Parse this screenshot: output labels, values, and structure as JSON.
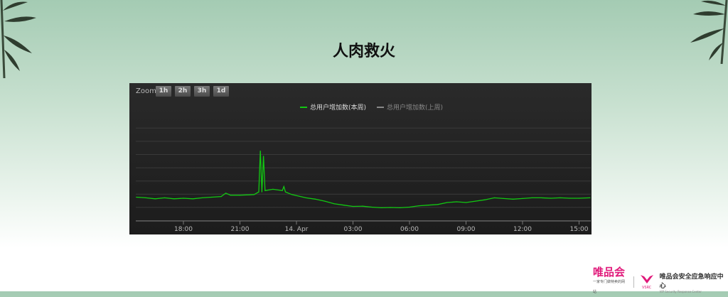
{
  "slide": {
    "title": "人肉救火"
  },
  "chart_toolbar": {
    "zoom_label": "Zoom",
    "buttons": [
      "1h",
      "2h",
      "3h",
      "1d"
    ]
  },
  "colors": {
    "this_week": "#12c812",
    "last_week": "#888888",
    "background": "#222222",
    "grid": "#3a3a3a"
  },
  "footer": {
    "brand": "唯品会",
    "brand_tagline": "一家专门做特卖的网站",
    "vsrc_mark": "VSRC",
    "vsrc_name": "唯品会安全应急响应中心",
    "vsrc_name_en": "VIP Security Response Center"
  },
  "chart_data": {
    "type": "line",
    "title": "",
    "xlabel": "",
    "ylabel": "",
    "x_ticks": [
      "18:00",
      "21:00",
      "14. Apr",
      "03:00",
      "06:00",
      "09:00",
      "12:00",
      "15:00"
    ],
    "y_ticks_shown": false,
    "grid": true,
    "legend_position": "top-center",
    "legend": [
      "总用户增加数(本周)",
      "总用户增加数(上周)"
    ],
    "series": [
      {
        "name": "总用户增加数(本周)",
        "color": "#12c812",
        "points": [
          [
            "13 15:30",
            1.8
          ],
          [
            "13 16:00",
            1.75
          ],
          [
            "13 16:30",
            1.68
          ],
          [
            "13 17:00",
            1.75
          ],
          [
            "13 17:30",
            1.68
          ],
          [
            "13 18:00",
            1.72
          ],
          [
            "13 18:30",
            1.68
          ],
          [
            "13 19:00",
            1.75
          ],
          [
            "13 19:30",
            1.8
          ],
          [
            "13 20:00",
            1.85
          ],
          [
            "13 20:15",
            2.1
          ],
          [
            "13 20:30",
            1.95
          ],
          [
            "13 21:00",
            1.95
          ],
          [
            "13 21:30",
            1.98
          ],
          [
            "13 21:45",
            2.0
          ],
          [
            "13 22:00",
            2.2
          ],
          [
            "13 22:05",
            5.3
          ],
          [
            "13 22:10",
            2.2
          ],
          [
            "13 22:15",
            4.9
          ],
          [
            "13 22:20",
            2.3
          ],
          [
            "13 22:45",
            2.4
          ],
          [
            "13 23:15",
            2.3
          ],
          [
            "13 23:20",
            2.6
          ],
          [
            "13 23:25",
            2.2
          ],
          [
            "13 23:45",
            2.0
          ],
          [
            "14 00:30",
            1.75
          ],
          [
            "14 01:00",
            1.65
          ],
          [
            "14 01:30",
            1.5
          ],
          [
            "14 02:00",
            1.3
          ],
          [
            "14 02:30",
            1.2
          ],
          [
            "14 03:00",
            1.1
          ],
          [
            "14 03:30",
            1.12
          ],
          [
            "14 04:00",
            1.05
          ],
          [
            "14 04:30",
            1.0
          ],
          [
            "14 05:00",
            1.02
          ],
          [
            "14 05:30",
            1.0
          ],
          [
            "14 06:00",
            1.05
          ],
          [
            "14 06:30",
            1.15
          ],
          [
            "14 07:00",
            1.2
          ],
          [
            "14 07:30",
            1.25
          ],
          [
            "14 08:00",
            1.4
          ],
          [
            "14 08:30",
            1.45
          ],
          [
            "14 09:00",
            1.4
          ],
          [
            "14 09:30",
            1.5
          ],
          [
            "14 10:00",
            1.6
          ],
          [
            "14 10:30",
            1.75
          ],
          [
            "14 11:00",
            1.7
          ],
          [
            "14 11:30",
            1.65
          ],
          [
            "14 12:00",
            1.7
          ],
          [
            "14 12:30",
            1.75
          ],
          [
            "14 13:00",
            1.75
          ],
          [
            "14 13:30",
            1.72
          ],
          [
            "14 14:00",
            1.75
          ],
          [
            "14 14:30",
            1.72
          ],
          [
            "14 15:00",
            1.72
          ],
          [
            "14 15:35",
            1.75
          ]
        ]
      },
      {
        "name": "总用户增加数(上周)",
        "color": "#888888",
        "points": []
      }
    ]
  }
}
